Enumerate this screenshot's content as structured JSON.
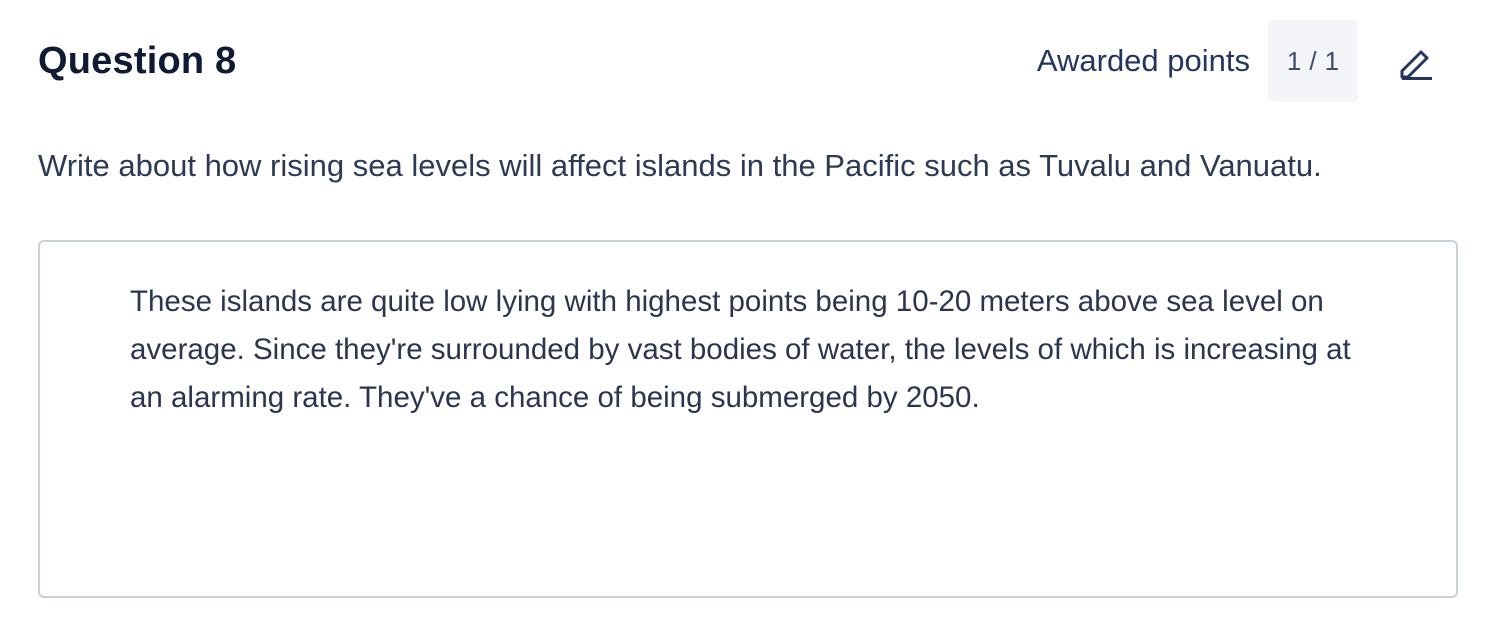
{
  "question": {
    "title": "Question 8",
    "prompt": "Write about how rising sea levels will affect islands in the Pacific such as Tuvalu and Vanuatu."
  },
  "points": {
    "label": "Awarded points",
    "awarded": "1",
    "separator": "/",
    "total": "1"
  },
  "edit": {
    "icon": "pencil-icon"
  },
  "answer": {
    "text": "These islands are quite low lying with highest points being 10-20 meters above sea level on average. Since they're surrounded by vast bodies of water, the levels of which is increasing at an alarming rate. They've a chance of being submerged by 2050."
  },
  "colors": {
    "heading": "#0e1b33",
    "text": "#2d3a55",
    "points_box_bg": "#f3f5f9",
    "border": "#c9d1de"
  }
}
